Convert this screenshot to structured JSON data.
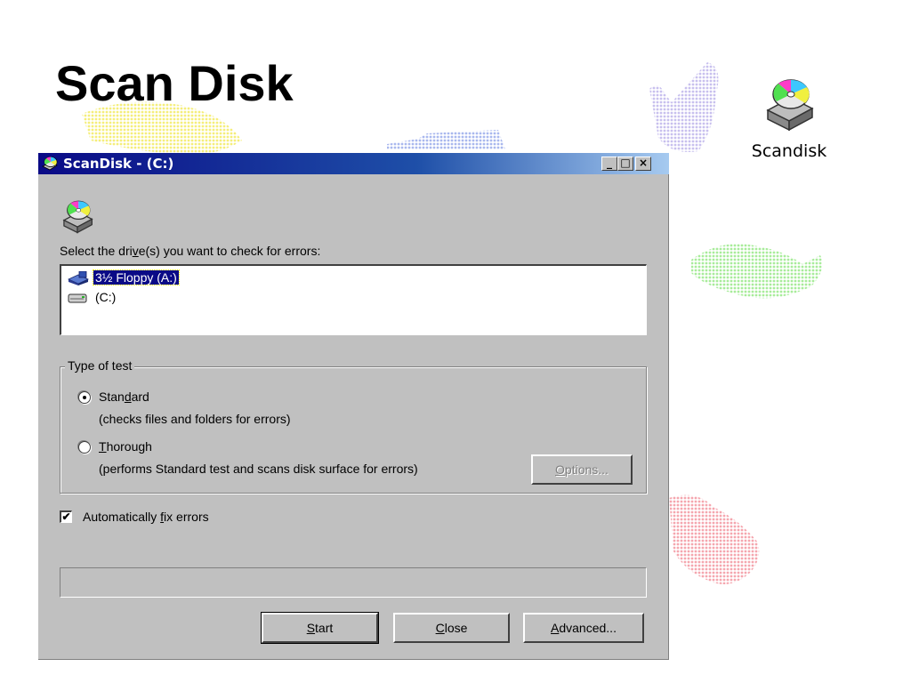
{
  "slide": {
    "title": "Scan Disk"
  },
  "desktop_icon": {
    "label": "Scandisk"
  },
  "window": {
    "title": "ScanDisk - (C:)",
    "controls": {
      "minimize": "_",
      "maximize": "□",
      "close": "×"
    },
    "prompt_pre": "Select the dri",
    "prompt_u": "v",
    "prompt_post": "e(s) you want to check for errors:",
    "drives": [
      {
        "label": "3½ Floppy (A:)",
        "selected": true,
        "icon": "floppy-drive-icon"
      },
      {
        "label": "(C:)",
        "selected": false,
        "icon": "hard-drive-icon"
      }
    ],
    "test_group": {
      "legend": "Type of test",
      "standard_pre": "Stan",
      "standard_u": "d",
      "standard_post": "ard",
      "standard_desc": "(checks files and folders for errors)",
      "standard_checked": true,
      "thorough_u": "T",
      "thorough_post": "horough",
      "thorough_desc": "(performs Standard test and scans disk surface for errors)",
      "thorough_checked": false,
      "options_u": "O",
      "options_post": "ptions..."
    },
    "autofix": {
      "pre": "Automatically ",
      "u": "f",
      "post": "ix errors",
      "checked": true,
      "check_glyph": "✔"
    },
    "buttons": {
      "start_u": "S",
      "start_post": "tart",
      "close_u": "C",
      "close_post": "lose",
      "advanced_u": "A",
      "advanced_post": "dvanced..."
    }
  },
  "colors": {
    "titlebar": "#0a0a86",
    "face": "#c0c0c0",
    "selection": "#0a0a86"
  }
}
